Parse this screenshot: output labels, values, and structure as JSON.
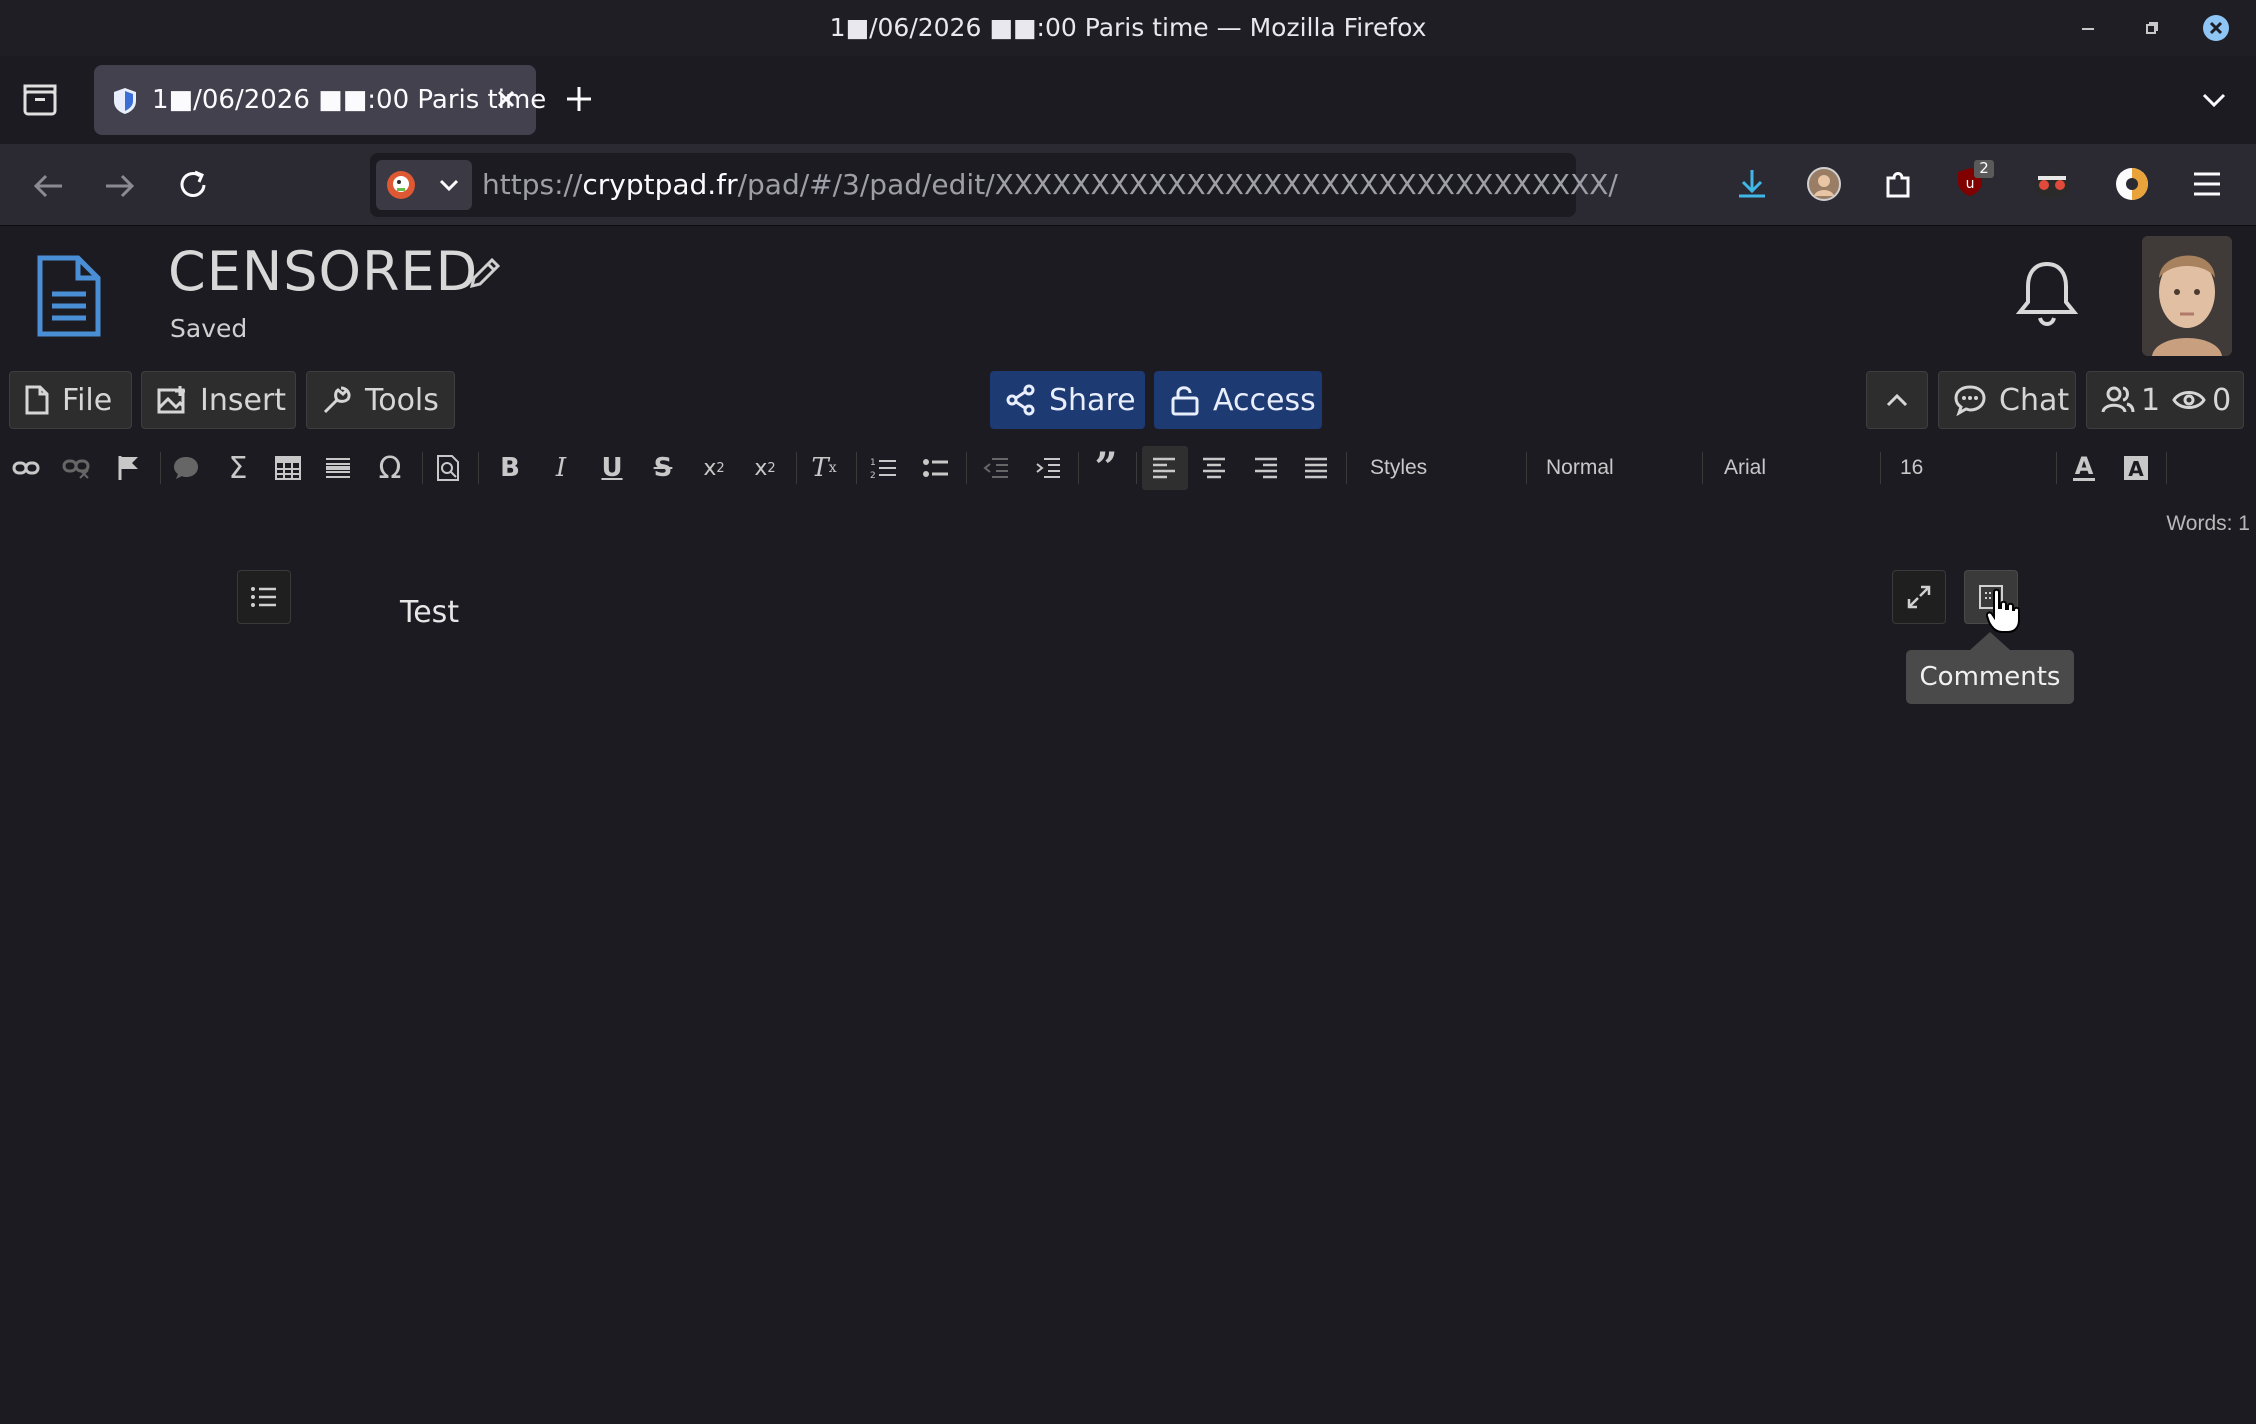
{
  "window": {
    "title": "1■/06/2026 ■■:00 Paris time — Mozilla Firefox"
  },
  "tabs": [
    {
      "label": "1■/06/2026 ■■:00 Paris time"
    }
  ],
  "navbar": {
    "url_prefix": "https://",
    "url_domain": "cryptpad.fr",
    "url_path": "/pad/#/3/pad/edit/XXXXXXXXXXXXXXXXXXXXXXXXXXXXXXXX/",
    "extension_badge": "2"
  },
  "app": {
    "doc_title": "CENSORED",
    "status": "Saved",
    "toolbar": {
      "file": "File",
      "insert": "Insert",
      "tools": "Tools",
      "share": "Share",
      "access": "Access",
      "chat": "Chat",
      "users_count": "1",
      "viewers_count": "0"
    },
    "editor": {
      "styles": "Styles",
      "format": "Normal",
      "font": "Arial",
      "size": "16",
      "words": "Words: 1"
    },
    "content": "Test",
    "tooltip": "Comments"
  },
  "colors": {
    "accent": "#1d3a73",
    "doc_icon": "#4a8fd6"
  }
}
